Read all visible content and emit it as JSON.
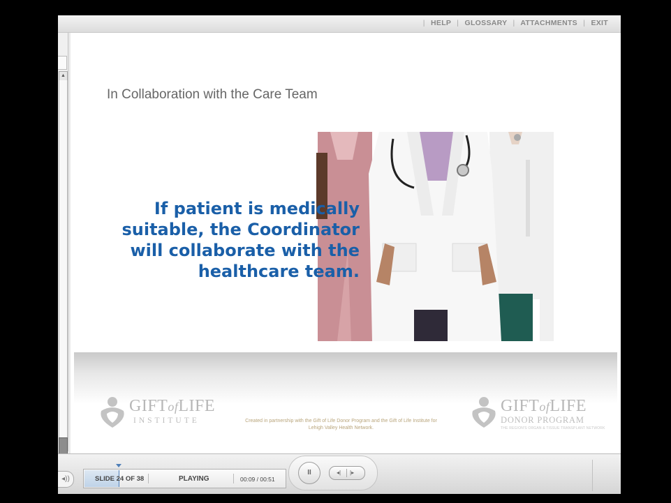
{
  "top_nav": {
    "items": [
      "HELP",
      "GLOSSARY",
      "ATTACHMENTS",
      "EXIT"
    ]
  },
  "slide": {
    "title": "In Collaboration with the Care Team",
    "callout_lines": [
      "If patient is medically",
      "suitable, the Coordinator",
      "will collaborate with the",
      "healthcare team."
    ],
    "callout_color": "#1a5fa8"
  },
  "footer": {
    "left_logo": {
      "word_start": "GIFT",
      "word_of": "of",
      "word_end": "LIFE",
      "sub": "INSTITUTE"
    },
    "partner_text": "Created in partnership with the Gift of Life Donor Program and the Gift of Life Institute for Lehigh Valley Health Network.",
    "right_logo": {
      "word_start": "GIFT",
      "word_of": "of",
      "word_end": "LIFE",
      "sub": "DONOR PROGRAM",
      "tagline": "THE REGION'S ORGAN & TISSUE TRANSPLANT NETWORK"
    }
  },
  "player": {
    "slide_counter": "SLIDE 24 OF 38",
    "state": "PLAYING",
    "time": "00:09 / 00:51",
    "progress": 0.17,
    "accent_color": "#4f7fb8"
  },
  "icons": {
    "volume": "speaker-icon",
    "pause": "pause-icon",
    "rewind": "rewind-icon",
    "forward": "forward-icon",
    "scroll_up": "arrow-up-icon",
    "scroll_down": "arrow-down-icon"
  }
}
